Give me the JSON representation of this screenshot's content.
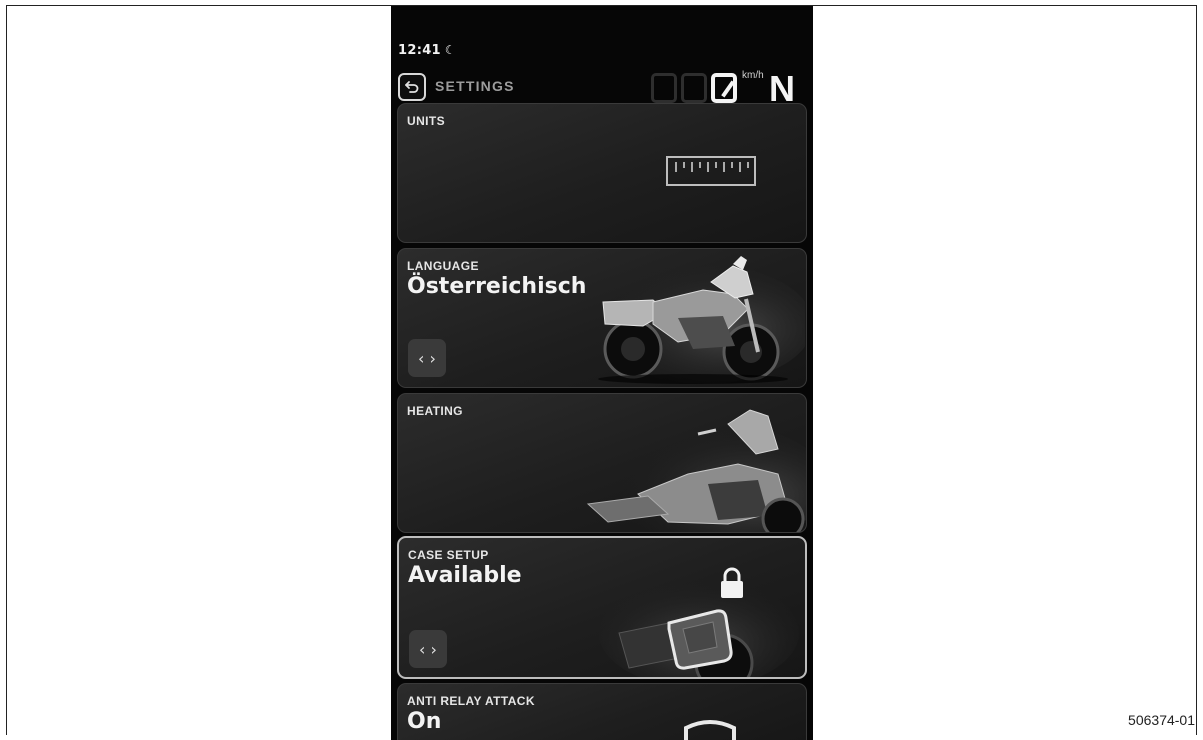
{
  "status_bar": {
    "time": "12:41",
    "night_icon": "moon-icon"
  },
  "header": {
    "back_icon": "back-arrow-icon",
    "title": "SETTINGS"
  },
  "speedometer": {
    "speed": "0",
    "unit": "km/h",
    "gear": "N"
  },
  "cards": [
    {
      "label": "UNITS",
      "icon": "ruler-icon"
    },
    {
      "label": "LANGUAGE",
      "value": "Österreichisch",
      "control_icon": "left-right-chevrons-icon"
    },
    {
      "label": "HEATING"
    },
    {
      "label": "CASE SETUP",
      "value": "Available",
      "control_icon": "left-right-chevrons-icon",
      "icon": "lock-icon"
    },
    {
      "label": "ANTI RELAY ATTACK",
      "value": "On",
      "icon": "shield-icon"
    }
  ],
  "arrows_glyph": "‹ ›",
  "reference_number": "506374-01"
}
